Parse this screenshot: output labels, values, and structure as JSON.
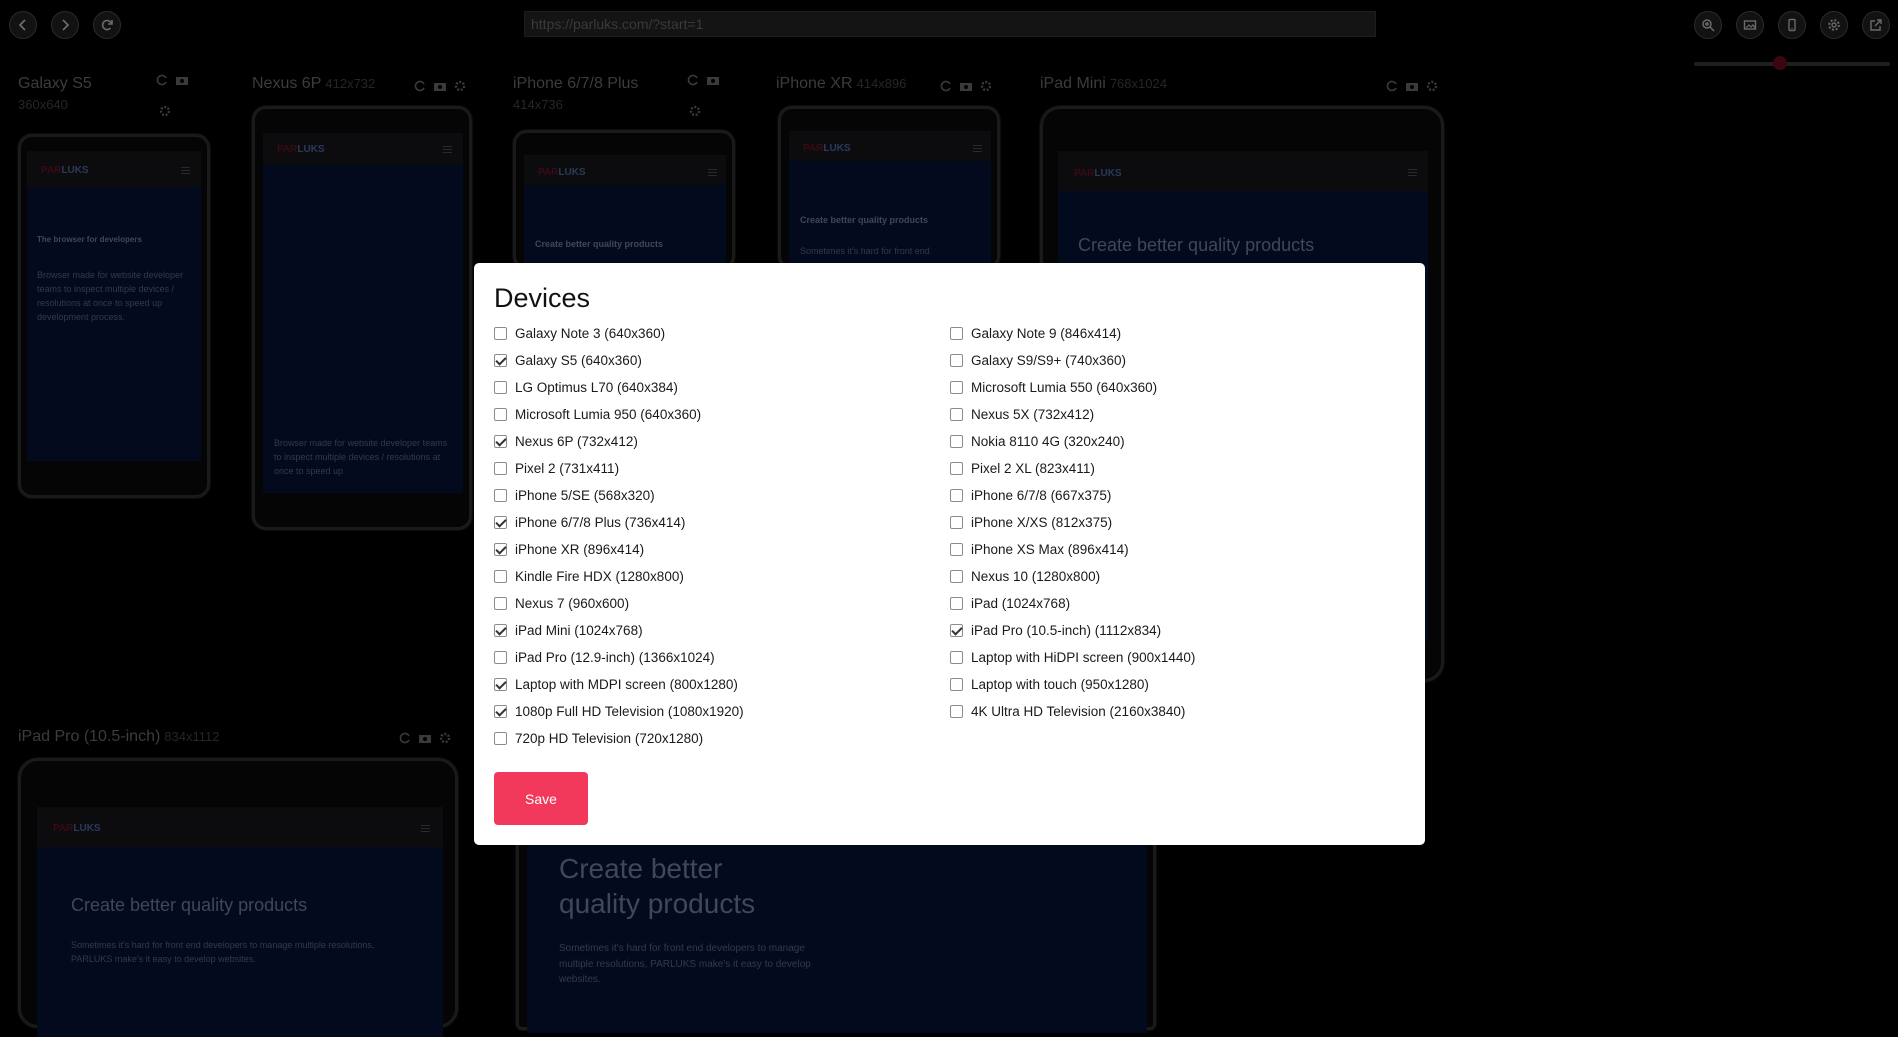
{
  "toolbar": {
    "url": "https://parluks.com/?start=1",
    "icons": [
      "back-icon",
      "forward-icon",
      "reload-icon",
      "zoom-in-icon",
      "gallery-icon",
      "mobile-icon",
      "gear-icon",
      "external-link-icon"
    ],
    "zoom_level": 0.4
  },
  "devices": [
    {
      "name": "Galaxy S5",
      "size": "360x640",
      "logo": "PARLUKS",
      "heading": "The browser for developers",
      "text": "Browser made for website developer teams to inspect multiple devices / resolutions at once to speed up development process."
    },
    {
      "name": "Nexus 6P",
      "size": "412x732",
      "logo": "PARLUKS",
      "text": "Browser made for website developer teams to inspect multiple devices / resolutions at once to speed up"
    },
    {
      "name": "iPhone 6/7/8 Plus",
      "size": "414x736",
      "logo": "PARLUKS",
      "heading": "Create better quality products"
    },
    {
      "name": "iPhone XR",
      "size": "414x896",
      "logo": "PARLUKS",
      "heading": "Create better quality products",
      "text": "Sometimes it's hard for front end"
    },
    {
      "name": "iPad Mini",
      "size": "768x1024",
      "logo": "PARLUKS",
      "heading": "Create better quality products"
    },
    {
      "name": "iPad Pro (10.5-inch)",
      "size": "834x1112",
      "logo": "PARLUKS",
      "heading": "Create better quality products",
      "text": "Sometimes it's hard for front end developers to manage multiple resolutions, PARLUKS make's it easy to develop websites."
    },
    {
      "heading": "Create better quality products",
      "text": "Sometimes it's hard for front end developers to manage multiple resolutions, PARLUKS make's it easy to develop websites."
    }
  ],
  "modal": {
    "title": "Devices",
    "save_label": "Save",
    "left": [
      {
        "label": "Galaxy Note 3 (640x360)",
        "checked": false
      },
      {
        "label": "Galaxy S5 (640x360)",
        "checked": true
      },
      {
        "label": "LG Optimus L70 (640x384)",
        "checked": false
      },
      {
        "label": "Microsoft Lumia 950 (640x360)",
        "checked": false
      },
      {
        "label": "Nexus 6P (732x412)",
        "checked": true
      },
      {
        "label": "Pixel 2 (731x411)",
        "checked": false
      },
      {
        "label": "iPhone 5/SE (568x320)",
        "checked": false
      },
      {
        "label": "iPhone 6/7/8 Plus (736x414)",
        "checked": true
      },
      {
        "label": "iPhone XR (896x414)",
        "checked": true
      },
      {
        "label": "Kindle Fire HDX (1280x800)",
        "checked": false
      },
      {
        "label": "Nexus 7 (960x600)",
        "checked": false
      },
      {
        "label": "iPad Mini (1024x768)",
        "checked": true
      },
      {
        "label": "iPad Pro (12.9-inch) (1366x1024)",
        "checked": false
      },
      {
        "label": "Laptop with MDPI screen (800x1280)",
        "checked": true
      },
      {
        "label": "1080p Full HD Television (1080x1920)",
        "checked": true
      },
      {
        "label": "720p HD Television (720x1280)",
        "checked": false
      }
    ],
    "right": [
      {
        "label": "Galaxy Note 9 (846x414)",
        "checked": false
      },
      {
        "label": "Galaxy S9/S9+ (740x360)",
        "checked": false
      },
      {
        "label": "Microsoft Lumia 550 (640x360)",
        "checked": false
      },
      {
        "label": "Nexus 5X (732x412)",
        "checked": false
      },
      {
        "label": "Nokia 8110 4G (320x240)",
        "checked": false
      },
      {
        "label": "Pixel 2 XL (823x411)",
        "checked": false
      },
      {
        "label": "iPhone 6/7/8 (667x375)",
        "checked": false
      },
      {
        "label": "iPhone X/XS (812x375)",
        "checked": false
      },
      {
        "label": "iPhone XS Max (896x414)",
        "checked": false
      },
      {
        "label": "Nexus 10 (1280x800)",
        "checked": false
      },
      {
        "label": "iPad (1024x768)",
        "checked": false
      },
      {
        "label": "iPad Pro (10.5-inch) (1112x834)",
        "checked": true
      },
      {
        "label": "Laptop with HiDPI screen (900x1440)",
        "checked": false
      },
      {
        "label": "Laptop with touch (950x1280)",
        "checked": false
      },
      {
        "label": "4K Ultra HD Television (2160x3840)",
        "checked": false
      }
    ]
  }
}
